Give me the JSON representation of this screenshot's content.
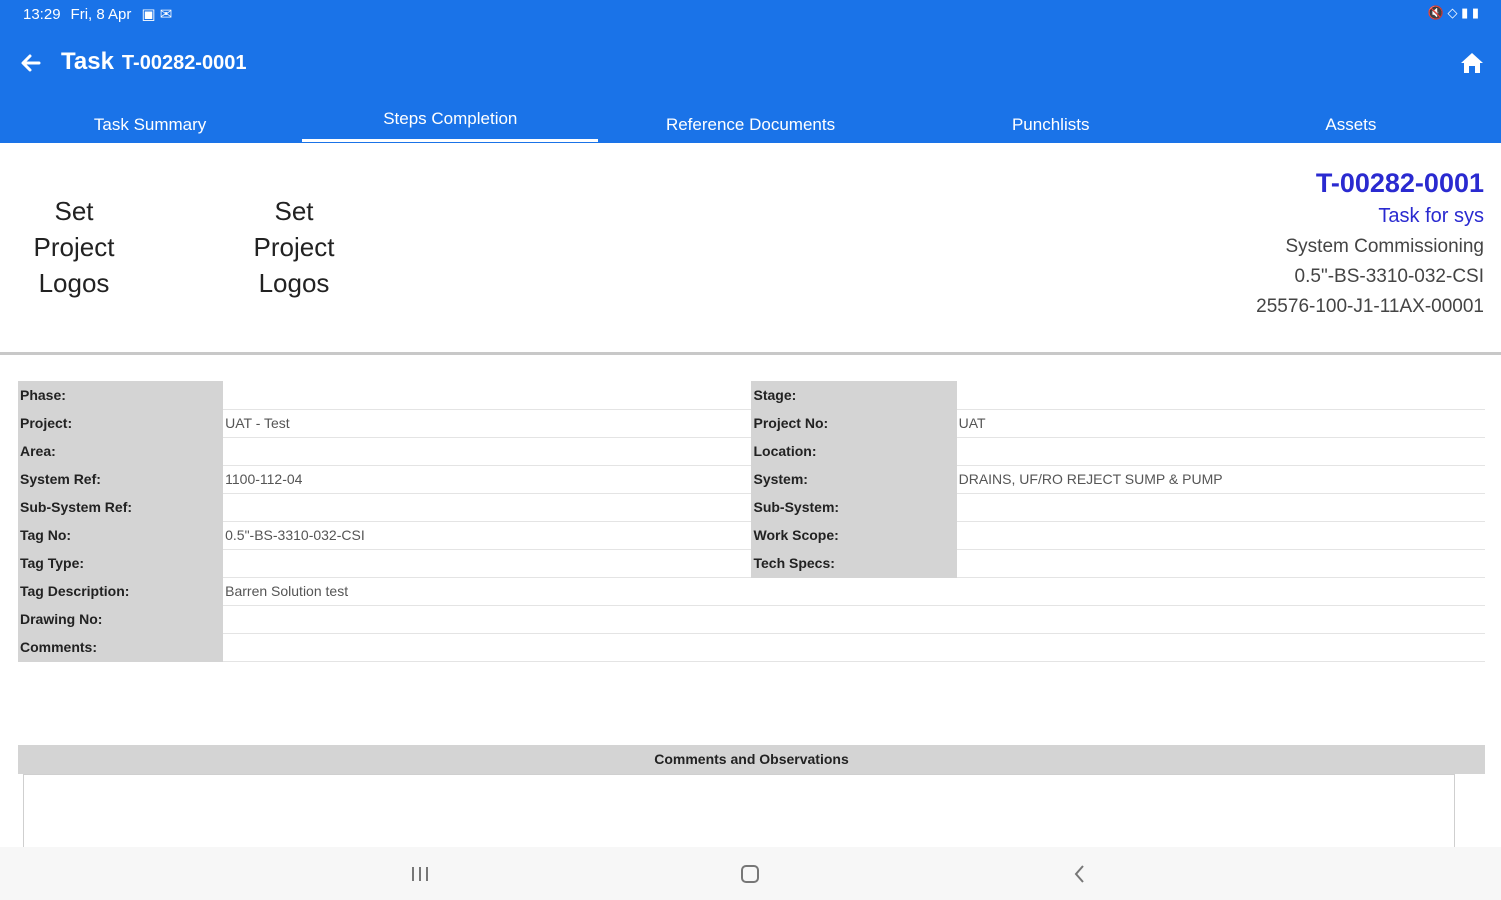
{
  "status_bar": {
    "time": "13:29",
    "date": "Fri, 8 Apr",
    "notification_icons": "▣ ✉",
    "right_icons": "🔇 ◇ ▮ ▮"
  },
  "app_bar": {
    "title": "Task",
    "task_id": "T-00282-0001",
    "back_icon": "arrow-back-icon",
    "home_icon": "home-icon",
    "color": "#1a73e8"
  },
  "tabs": [
    {
      "label": "Task Summary",
      "active": false
    },
    {
      "label": "Steps Completion",
      "active": true
    },
    {
      "label": "Reference Documents",
      "active": false
    },
    {
      "label": "Punchlists",
      "active": false
    },
    {
      "label": "Assets",
      "active": false
    }
  ],
  "header": {
    "logo_left": [
      "Set",
      "Project",
      "Logos"
    ],
    "logo_right": [
      "Set",
      "Project",
      "Logos"
    ],
    "id": "T-00282-0001",
    "subtitle": "Task for sys",
    "lines": [
      "System Commissioning",
      "0.5\"-BS-3310-032-CSI",
      "25576-100-J1-11AX-00001"
    ]
  },
  "info_rows": [
    {
      "l1": "Phase:",
      "v1": "",
      "l2": "Stage:",
      "v2": ""
    },
    {
      "l1": "Project:",
      "v1": "UAT - Test",
      "l2": "Project No:",
      "v2": "UAT"
    },
    {
      "l1": "Area:",
      "v1": "",
      "l2": "Location:",
      "v2": ""
    },
    {
      "l1": "System Ref:",
      "v1": "1100-112-04",
      "l2": "System:",
      "v2": "DRAINS, UF/RO REJECT SUMP & PUMP"
    },
    {
      "l1": "Sub-System Ref:",
      "v1": "",
      "l2": "Sub-System:",
      "v2": ""
    },
    {
      "l1": "Tag No:",
      "v1": "0.5\"-BS-3310-032-CSI",
      "l2": "Work Scope:",
      "v2": ""
    },
    {
      "l1": "Tag Type:",
      "v1": "",
      "l2": "Tech Specs:",
      "v2": ""
    },
    {
      "l1": "Tag Description:",
      "v1": "Barren Solution test"
    },
    {
      "l1": "Drawing No:",
      "v1": ""
    },
    {
      "l1": "Comments:",
      "v1": ""
    }
  ],
  "comments_section": {
    "title": "Comments and Observations",
    "value": ""
  },
  "nav_bar": {
    "recents_icon": "recents-icon",
    "home_icon": "home-circle-icon",
    "back_icon": "chevron-left-icon"
  }
}
